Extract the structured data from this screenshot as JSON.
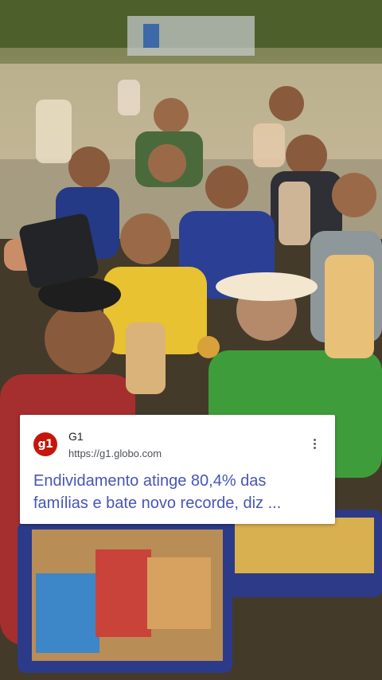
{
  "result_card": {
    "logo_text": "g1",
    "site_name": "G1",
    "url": "https://g1.globo.com",
    "headline": "Endividamento atinge 80,4% das famílias e bate novo recorde, diz ...",
    "more_icon": "more-vert-icon"
  },
  "colors": {
    "logo_red": "#c4170c",
    "headline_blue": "#4756b4"
  }
}
